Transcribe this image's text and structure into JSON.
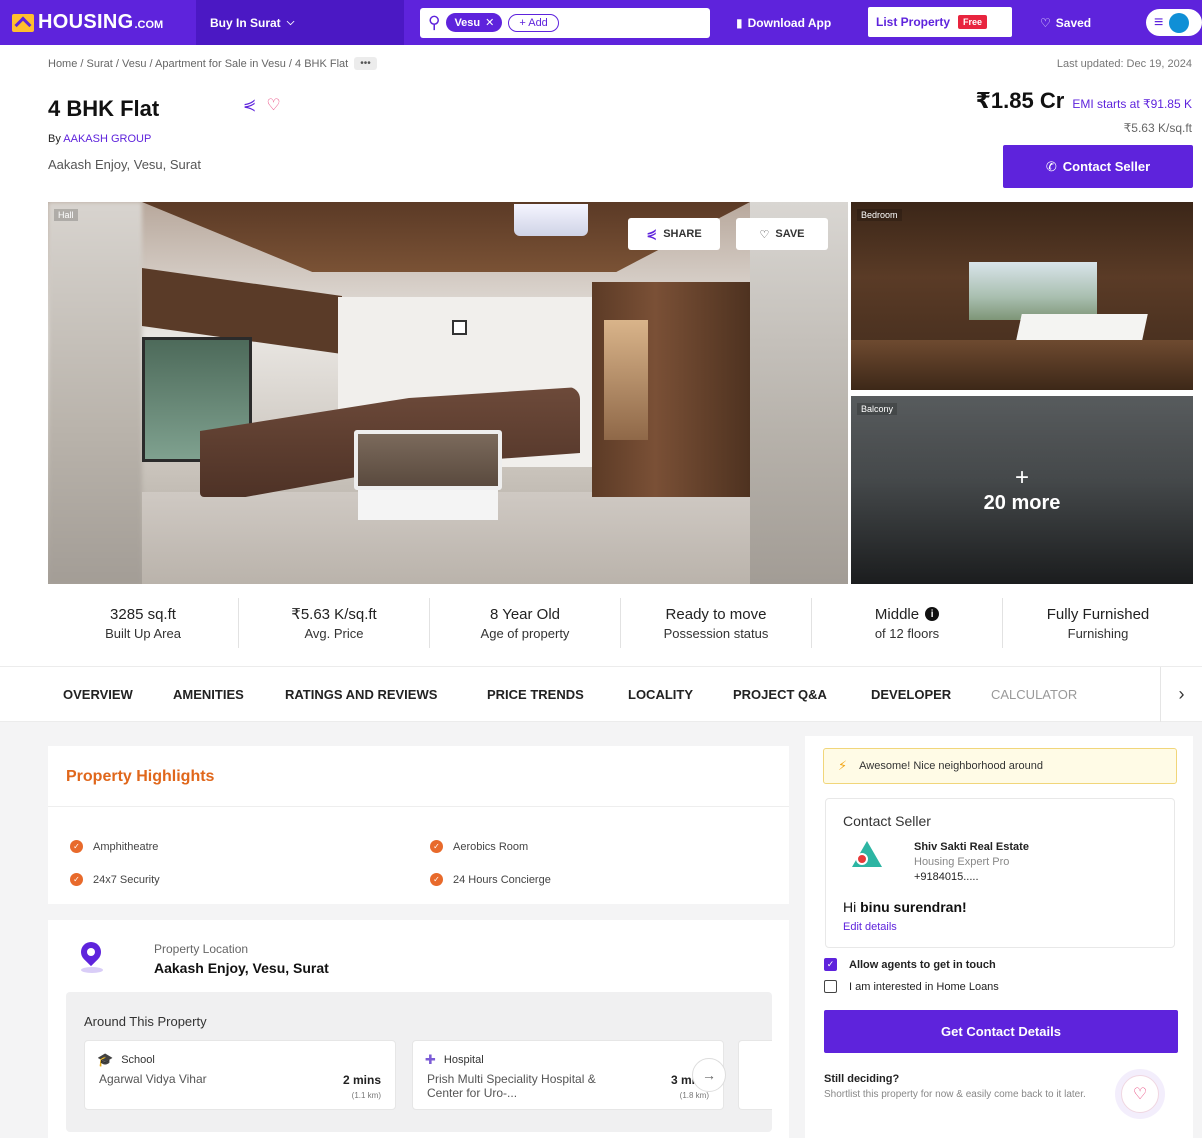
{
  "nav": {
    "logo_text": "HOUSING",
    "logo_domain": ".COM",
    "city_select": "Buy In Surat",
    "search_chip": "Vesu",
    "add_chip": "+ Add",
    "download_app": "Download App",
    "list_property": "List Property",
    "free_badge": "Free",
    "saved": "Saved"
  },
  "breadcrumb": {
    "path": "Home / Surat / Vesu / Apartment for Sale in Vesu / 4 BHK Flat",
    "more": "•••"
  },
  "header": {
    "last_updated": "Last updated: Dec 19, 2024",
    "title": "4 BHK Flat",
    "by_label": "By",
    "builder": "AAKASH GROUP",
    "address": "Aakash Enjoy, Vesu, Surat",
    "price": "₹1.85 Cr",
    "emi": "EMI starts at ₹91.85 K",
    "price_per_sqft": "₹5.63 K/sq.ft",
    "contact_button": "Contact Seller"
  },
  "gallery": {
    "main_tag": "Hall",
    "share_label": "SHARE",
    "save_label": "SAVE",
    "bedroom_tag": "Bedroom",
    "balcony_tag": "Balcony",
    "more_plus": "+",
    "more_text": "20 more"
  },
  "stats": [
    {
      "value": "3285 sq.ft",
      "label": "Built Up Area"
    },
    {
      "value": "₹5.63 K/sq.ft",
      "label": "Avg. Price"
    },
    {
      "value": "8 Year Old",
      "label": "Age of property"
    },
    {
      "value": "Ready to move",
      "label": "Possession status"
    },
    {
      "value": "Middle",
      "label": "of 12 floors"
    },
    {
      "value": "Fully Furnished",
      "label": "Furnishing"
    }
  ],
  "tabs": [
    "OVERVIEW",
    "AMENITIES",
    "RATINGS AND REVIEWS",
    "PRICE TRENDS",
    "LOCALITY",
    "PROJECT Q&A",
    "DEVELOPER",
    "CALCULATOR"
  ],
  "highlights": {
    "title": "Property Highlights",
    "items": [
      "Amphitheatre",
      "Aerobics Room",
      "24x7 Security",
      "24 Hours Concierge"
    ]
  },
  "location": {
    "label": "Property Location",
    "name": "Aakash Enjoy, Vesu, Surat",
    "around_title": "Around This Property",
    "places": [
      {
        "type": "School",
        "name": "Agarwal Vidya Vihar",
        "time": "2 mins",
        "dist": "(1.1 km)"
      },
      {
        "type": "Hospital",
        "name": "Prish Multi Speciality Hospital & Center for Uro-...",
        "time": "3 mins",
        "dist": "(1.8 km)"
      }
    ]
  },
  "side": {
    "awesome": "Awesome! Nice neighborhood around",
    "contact_title": "Contact Seller",
    "agent_name": "Shiv Sakti Real Estate",
    "agent_role": "Housing Expert Pro",
    "agent_phone": "+9184015.....",
    "greet_prefix": "Hi",
    "greet_name": "binu surendran!",
    "edit_details": "Edit details",
    "allow_agents": "Allow agents to get in touch",
    "home_loans": "I am interested in Home Loans",
    "get_contact": "Get Contact Details",
    "still_deciding": "Still deciding?",
    "shortlist_text": "Shortlist this property for now & easily come back to it later."
  }
}
